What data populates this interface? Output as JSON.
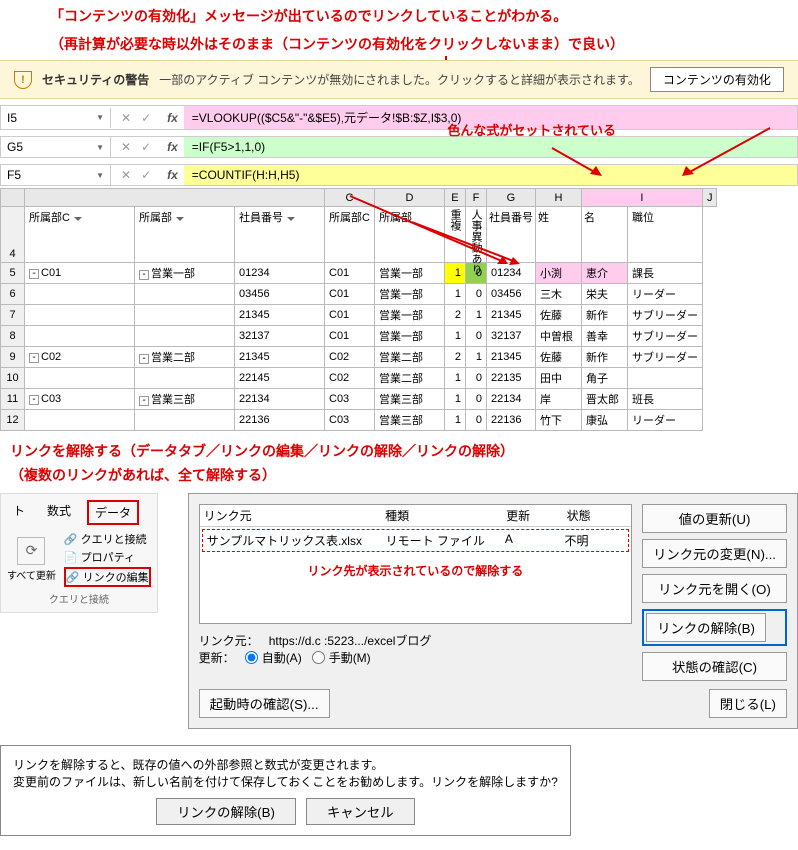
{
  "annotations": {
    "line1": "「コンテンツの有効化」メッセージが出ているのでリンクしていることがわかる。",
    "line2": "（再計算が必要な時以外はそのまま（コンテンツの有効化をクリックしないまま）で良い）",
    "formula_note": "色んな式がセットされている",
    "break_link_title": "リンクを解除する（データタブ／リンクの編集／リンクの解除／リンクの解除）",
    "break_link_sub": "（複数のリンクがあれば、全て解除する）",
    "link_list_note": "リンク先が表示されているので解除する"
  },
  "security": {
    "title": "セキュリティの警告",
    "msg": "一部のアクティブ コンテンツが無効にされました。クリックすると詳細が表示されます。",
    "button": "コンテンツの有効化"
  },
  "formula_bars": [
    {
      "name": "I5",
      "formula": "=VLOOKUP(($C5&\"-\"&$E5),元データ!$B:$Z,I$3,0)",
      "cls": "fhl-pink"
    },
    {
      "name": "G5",
      "formula": "=IF(F5>1,1,0)",
      "cls": "fhl-green"
    },
    {
      "name": "F5",
      "formula": "=COUNTIF(H:H,H5)",
      "cls": "fhl-yellow"
    }
  ],
  "icons": {
    "cancel": "✕",
    "check": "✓",
    "fx": "fx"
  },
  "left_headers": [
    "所属部C",
    "所属部",
    "社員番号"
  ],
  "right_headers": [
    "所属部C",
    "所属部",
    "重複",
    "人事異動あり",
    "社員番号",
    "姓",
    "名",
    "職位"
  ],
  "col_letters": [
    "C",
    "D",
    "E",
    "F",
    "G",
    "H",
    "I",
    "J"
  ],
  "left_rows": [
    {
      "rn": "5",
      "c": "C01",
      "d": "営業一部",
      "e": "01234"
    },
    {
      "rn": "6",
      "c": "",
      "d": "",
      "e": "03456"
    },
    {
      "rn": "7",
      "c": "",
      "d": "",
      "e": "21345"
    },
    {
      "rn": "8",
      "c": "",
      "d": "",
      "e": "32137"
    },
    {
      "rn": "9",
      "c": "C02",
      "d": "営業二部",
      "e": "21345"
    },
    {
      "rn": "10",
      "c": "",
      "d": "",
      "e": "22145"
    },
    {
      "rn": "11",
      "c": "C03",
      "d": "営業三部",
      "e": "22134"
    },
    {
      "rn": "12",
      "c": "",
      "d": "",
      "e": "22136"
    }
  ],
  "right_rows": [
    {
      "c": "C01",
      "d": "営業一部",
      "f": "1",
      "g": "0",
      "h": "01234",
      "i1": "小渕",
      "i2": "恵介",
      "j": "課長",
      "pink": true,
      "yellow_f": true,
      "green_g": true
    },
    {
      "c": "C01",
      "d": "営業一部",
      "f": "1",
      "g": "0",
      "h": "03456",
      "i1": "三木",
      "i2": "栄夫",
      "j": "リーダー"
    },
    {
      "c": "C01",
      "d": "営業一部",
      "f": "2",
      "g": "1",
      "h": "21345",
      "i1": "佐藤",
      "i2": "新作",
      "j": "サブリーダー"
    },
    {
      "c": "C01",
      "d": "営業一部",
      "f": "1",
      "g": "0",
      "h": "32137",
      "i1": "中曽根",
      "i2": "善幸",
      "j": "サブリーダー"
    },
    {
      "c": "C02",
      "d": "営業二部",
      "f": "2",
      "g": "1",
      "h": "21345",
      "i1": "佐藤",
      "i2": "新作",
      "j": "サブリーダー"
    },
    {
      "c": "C02",
      "d": "営業二部",
      "f": "1",
      "g": "0",
      "h": "22135",
      "i1": "田中",
      "i2": "角子",
      "j": ""
    },
    {
      "c": "C03",
      "d": "営業三部",
      "f": "1",
      "g": "0",
      "h": "22134",
      "i1": "岸",
      "i2": "晋太郎",
      "j": "班長"
    },
    {
      "c": "C03",
      "d": "営業三部",
      "f": "1",
      "g": "0",
      "h": "22136",
      "i1": "竹下",
      "i2": "康弘",
      "j": "リーダー"
    }
  ],
  "ribbon": {
    "tab_home": "ト",
    "tab_formula": "数式",
    "tab_data": "データ",
    "refresh_all": "すべて更新",
    "query_conn": "クエリと接続",
    "properties": "プロパティ",
    "edit_links": "リンクの編集",
    "group": "クエリと接続"
  },
  "dialog": {
    "col_source": "リンク元",
    "col_type": "種類",
    "col_update": "更新",
    "col_status": "状態",
    "row_source": "サンプルマトリックス表.xlsx",
    "row_type": "リモート ファイル",
    "row_update": "A",
    "row_status": "不明",
    "btn_update_values": "値の更新(U)",
    "btn_change_source": "リンク元の変更(N)...",
    "btn_open_source": "リンク元を開く(O)",
    "btn_break_link": "リンクの解除(B)",
    "btn_check_status": "状態の確認(C)",
    "src_label": "リンク元：",
    "src_value": "https://d.c                                          :5223.../excelブログ",
    "upd_label": "更新：",
    "radio_auto": "自動(A)",
    "radio_manual": "手動(M)",
    "btn_startup": "起動時の確認(S)...",
    "btn_close": "閉じる(L)"
  },
  "msgbox": {
    "line1": "リンクを解除すると、既存の値への外部参照と数式が変更されます。",
    "line2": "変更前のファイルは、新しい名前を付けて保存しておくことをお勧めします。リンクを解除しますか?",
    "ok": "リンクの解除(B)",
    "cancel": "キャンセル"
  }
}
